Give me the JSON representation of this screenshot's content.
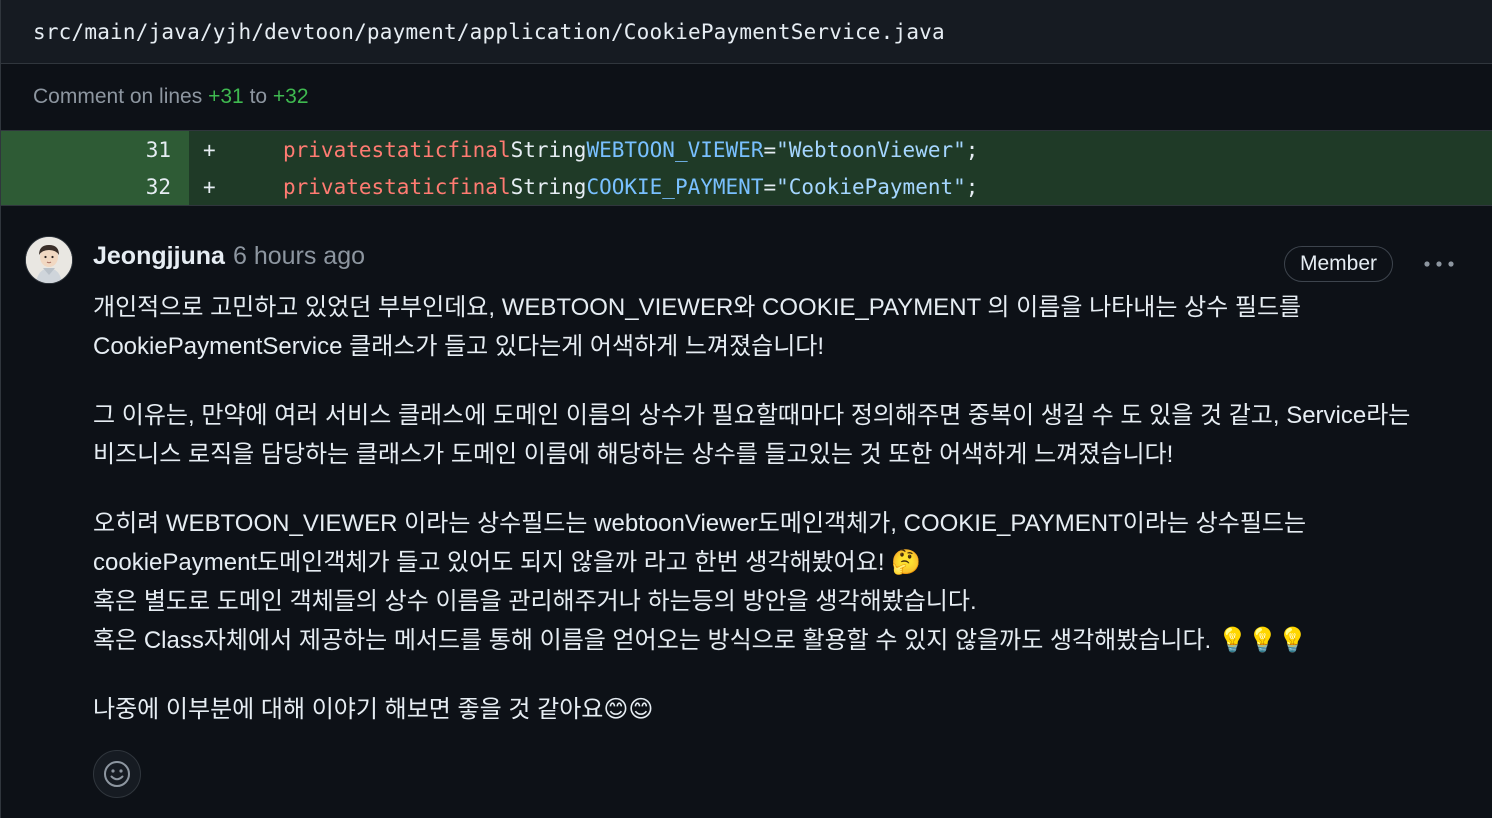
{
  "file": {
    "path": "src/main/java/yjh/devtoon/payment/application/CookiePaymentService.java"
  },
  "comment_range": {
    "prefix": "Comment on lines",
    "start": "+31",
    "mid": "to",
    "end": "+32"
  },
  "diff": {
    "lines": [
      {
        "num": "31",
        "sign": "+",
        "kw1": "private",
        "kw2": "static",
        "kw3": "final",
        "type": "String",
        "name": "WEBTOON_VIEWER",
        "eq": "=",
        "value": "\"WebtoonViewer\"",
        "end": ";"
      },
      {
        "num": "32",
        "sign": "+",
        "kw1": "private",
        "kw2": "static",
        "kw3": "final",
        "type": "String",
        "name": "COOKIE_PAYMENT",
        "eq": "=",
        "value": "\"CookiePayment\"",
        "end": ";"
      }
    ]
  },
  "comment": {
    "author": "Jeongjjuna",
    "time": "6 hours ago",
    "badge": "Member",
    "more_icon": "kebab-horizontal-icon",
    "paragraphs": [
      [
        "개인적으로 고민하고 있었던 부부인데요, WEBTOON_VIEWER와 COOKIE_PAYMENT 의 이름을 나타내는 상수 필드를",
        "CookiePaymentService 클래스가 들고 있다는게 어색하게 느껴졌습니다!"
      ],
      [
        "그 이유는, 만약에 여러 서비스 클래스에 도메인 이름의 상수가 필요할때마다 정의해주면 중복이 생길 수 도 있을 것 같고, Service라는",
        "비즈니스 로직을 담당하는 클래스가 도메인 이름에 해당하는 상수를 들고있는 것 또한 어색하게 느껴졌습니다!"
      ],
      [
        "오히려 WEBTOON_VIEWER 이라는 상수필드는 webtoonViewer도메인객체가, COOKIE_PAYMENT이라는 상수필드는",
        "cookiePayment도메인객체가 들고 있어도 되지 않을까 라고 한번 생각해봤어요! 🤔",
        "혹은 별도로 도메인 객체들의 상수 이름을 관리해주거나 하는등의 방안을 생각해봤습니다.",
        "혹은 Class자체에서 제공하는 메서드를 통해 이름을 얻어오는 방식으로 활용할 수 있지 않을까도 생각해봤습니다. 💡💡💡"
      ],
      [
        "나중에 이부분에 대해 이야기 해보면 좋을 것 같아요😊😊"
      ]
    ],
    "reaction_icon": "smiley-icon"
  },
  "colors": {
    "background": "#0d1117",
    "header_bg": "#161b22",
    "border": "#30363d",
    "added_num_bg": "#2e5b35",
    "added_code_bg": "#1f3a27",
    "keyword": "#ff7b72",
    "constant": "#79c0ff",
    "string": "#a5d6ff",
    "added_text": "#3fb950",
    "muted": "#8d96a0"
  }
}
